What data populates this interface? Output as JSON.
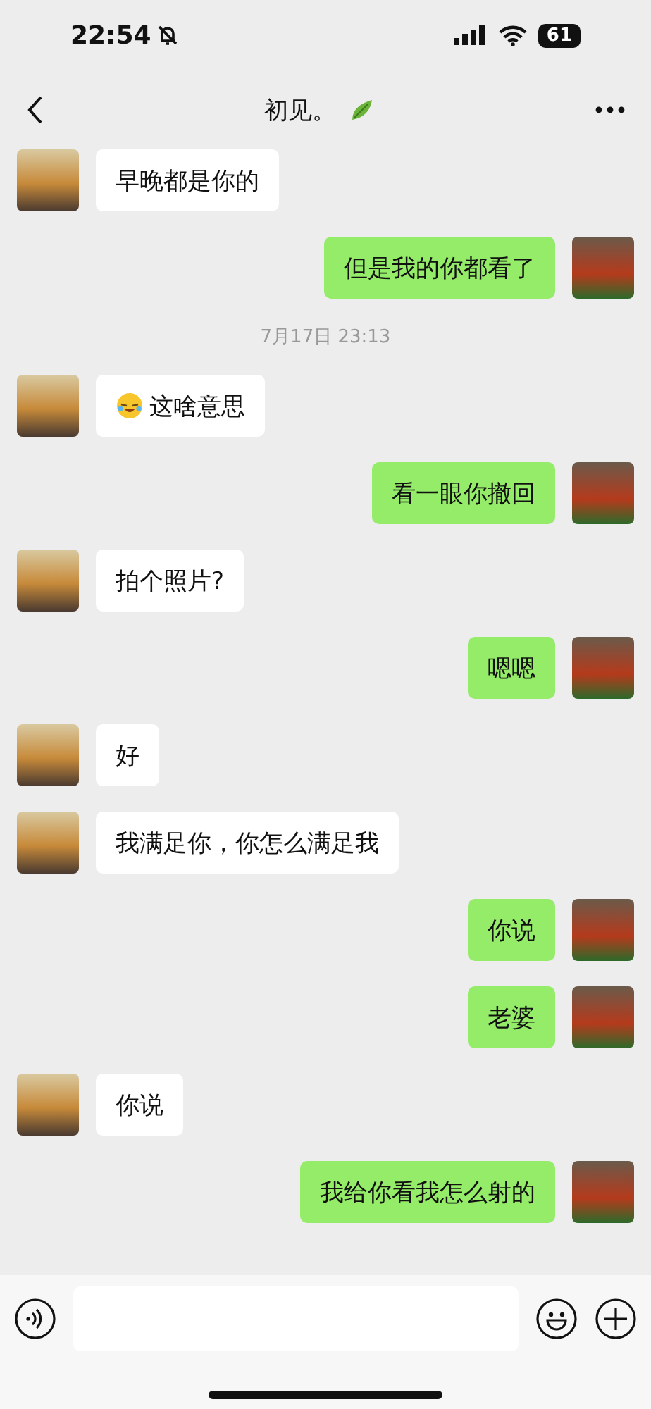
{
  "status_bar": {
    "time": "22:54",
    "battery": "61"
  },
  "header": {
    "title": "初见。"
  },
  "messages": [
    {
      "kind": "them",
      "text": "早晚都是你的"
    },
    {
      "kind": "me",
      "text": "但是我的你都看了"
    },
    {
      "kind": "time",
      "text": "7月17日 23:13"
    },
    {
      "kind": "them_emoji",
      "text": "这啥意思"
    },
    {
      "kind": "me",
      "text": "看一眼你撤回"
    },
    {
      "kind": "them",
      "text": "拍个照片?"
    },
    {
      "kind": "me",
      "text": "嗯嗯"
    },
    {
      "kind": "them",
      "text": "好"
    },
    {
      "kind": "them",
      "text": "我满足你，你怎么满足我"
    },
    {
      "kind": "me",
      "text": "你说"
    },
    {
      "kind": "me",
      "text": "老婆"
    },
    {
      "kind": "them",
      "text": "你说"
    },
    {
      "kind": "me",
      "text": "我给你看我怎么射的"
    }
  ]
}
